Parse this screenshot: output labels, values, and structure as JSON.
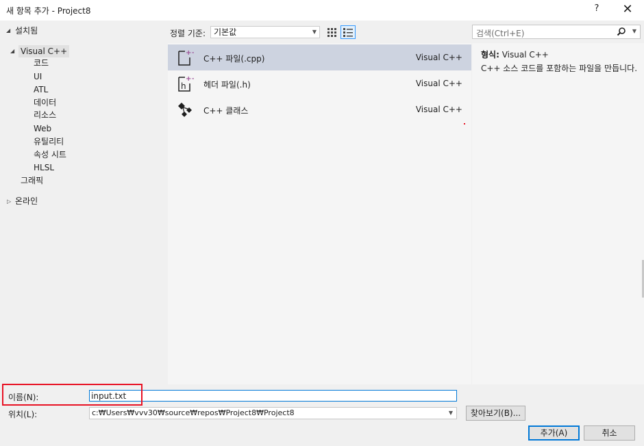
{
  "window": {
    "title": "새 항목 추가 - Project8",
    "help_label": "?",
    "close_glyph": "✕"
  },
  "tree": {
    "installed": "설치됨",
    "visual_cpp": "Visual C++",
    "children": [
      "코드",
      "UI",
      "ATL",
      "데이터",
      "리소스",
      "Web",
      "유틸리티",
      "속성 시트",
      "HLSL"
    ],
    "graphics": "그래픽",
    "online": "온라인"
  },
  "sort": {
    "label": "정렬 기준:",
    "value": "기본값"
  },
  "templates": [
    {
      "name": "C++ 파일(.cpp)",
      "type": "Visual C++"
    },
    {
      "name": "헤더 파일(.h)",
      "type": "Visual C++"
    },
    {
      "name": "C++ 클래스",
      "type": "Visual C++"
    }
  ],
  "search": {
    "placeholder": "검색(Ctrl+E)"
  },
  "detail": {
    "type_label": "형식:",
    "type_value": "Visual C++",
    "description": "C++ 소스 코드를 포함하는 파일을 만듭니다."
  },
  "form": {
    "name_label": "이름(N):",
    "name_value": "input.txt",
    "location_label": "위치(L):",
    "location_value": "c:₩Users₩vvv30₩source₩repos₩Project8₩Project8",
    "browse_label": "찾아보기(B)...",
    "add_label": "추가(A)",
    "cancel_label": "취소"
  },
  "colors": {
    "accent": "#0078d7",
    "highlight": "#e81123",
    "selected_row": "#cdd3e0",
    "cpp_badge": "#9b4f96"
  }
}
